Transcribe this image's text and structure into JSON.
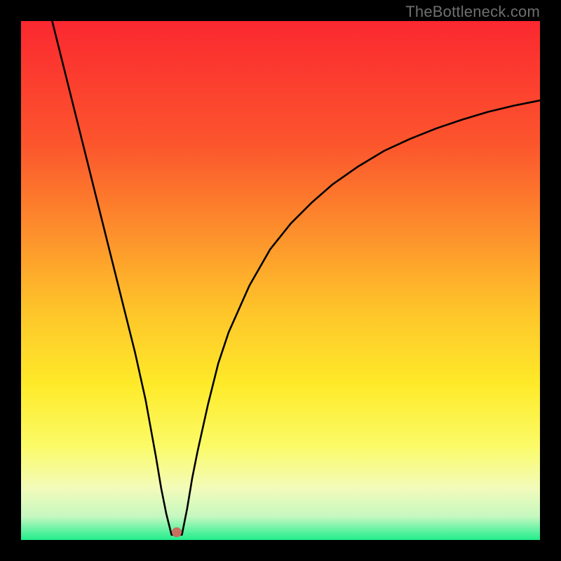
{
  "watermark": "TheBottleneck.com",
  "colors": {
    "top": "#fb2830",
    "mid_upper": "#fd8d2c",
    "mid": "#feda29",
    "mid_lower": "#f9fb9a",
    "bottom": "#23ed8a",
    "curve": "#000000",
    "dot": "#c86f5f",
    "background": "#000000"
  },
  "chart_data": {
    "type": "line",
    "title": "",
    "xlabel": "",
    "ylabel": "",
    "xlim": [
      0,
      100
    ],
    "ylim": [
      0,
      100
    ],
    "annotations": [],
    "dot": {
      "x": 30,
      "y": 1.5
    },
    "series": [
      {
        "name": "left-branch",
        "x": [
          6,
          8,
          10,
          12,
          14,
          16,
          18,
          20,
          22,
          24,
          26,
          27,
          28,
          29
        ],
        "y": [
          100,
          92,
          84,
          76,
          68,
          60,
          52,
          44,
          36,
          27,
          16,
          10,
          5,
          1
        ]
      },
      {
        "name": "valley-floor",
        "x": [
          29,
          30,
          31
        ],
        "y": [
          1,
          1,
          1
        ]
      },
      {
        "name": "right-branch",
        "x": [
          31,
          32,
          33,
          34,
          36,
          38,
          40,
          44,
          48,
          52,
          56,
          60,
          65,
          70,
          75,
          80,
          85,
          90,
          95,
          100
        ],
        "y": [
          1,
          6,
          12,
          17,
          26,
          34,
          40,
          49,
          56,
          61,
          65,
          68.5,
          72,
          75,
          77.3,
          79.3,
          81,
          82.5,
          83.7,
          84.7
        ]
      }
    ]
  }
}
